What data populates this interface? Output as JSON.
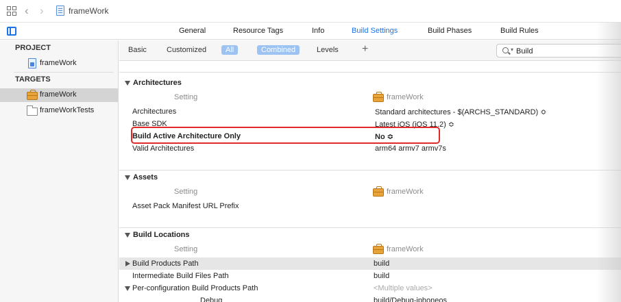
{
  "pathbar": {
    "file_name": "frameWork"
  },
  "tabs": [
    {
      "label": "General",
      "active": false
    },
    {
      "label": "Resource Tags",
      "active": false
    },
    {
      "label": "Info",
      "active": false
    },
    {
      "label": "Build Settings",
      "active": true
    },
    {
      "label": "Build Phases",
      "active": false
    },
    {
      "label": "Build Rules",
      "active": false
    }
  ],
  "navigator": {
    "project_heading": "PROJECT",
    "project_item": "frameWork",
    "targets_heading": "TARGETS",
    "targets": [
      {
        "label": "frameWork",
        "selected": true
      },
      {
        "label": "frameWorkTests",
        "selected": false
      }
    ]
  },
  "filterbar": {
    "basic": "Basic",
    "customized": "Customized",
    "all": "All",
    "combined": "Combined",
    "levels": "Levels",
    "search_value": "Build"
  },
  "sections": {
    "architectures": {
      "title": "Architectures",
      "col_setting": "Setting",
      "col_target": "frameWork",
      "rows": [
        {
          "setting": "Architectures",
          "value": "Standard architectures  -  $(ARCHS_STANDARD) ≎"
        },
        {
          "setting": "Base SDK",
          "value": "Latest iOS (iOS 11.2) ≎"
        },
        {
          "setting": "Build Active Architecture Only",
          "value": "No ≎"
        },
        {
          "setting": "Valid Architectures",
          "value": "arm64 armv7 armv7s"
        }
      ]
    },
    "assets": {
      "title": "Assets",
      "col_setting": "Setting",
      "col_target": "frameWork",
      "rows": [
        {
          "setting": "Asset Pack Manifest URL Prefix",
          "value": ""
        }
      ]
    },
    "build_locations": {
      "title": "Build Locations",
      "col_setting": "Setting",
      "col_target": "frameWork",
      "rows": [
        {
          "setting": "Build Products Path",
          "value": "build"
        },
        {
          "setting": "Intermediate Build Files Path",
          "value": "build"
        },
        {
          "setting": "Per-configuration Build Products Path",
          "value": "<Multiple values>"
        },
        {
          "setting": "Debug",
          "value": "build/Debug-iphoneos"
        }
      ]
    }
  }
}
